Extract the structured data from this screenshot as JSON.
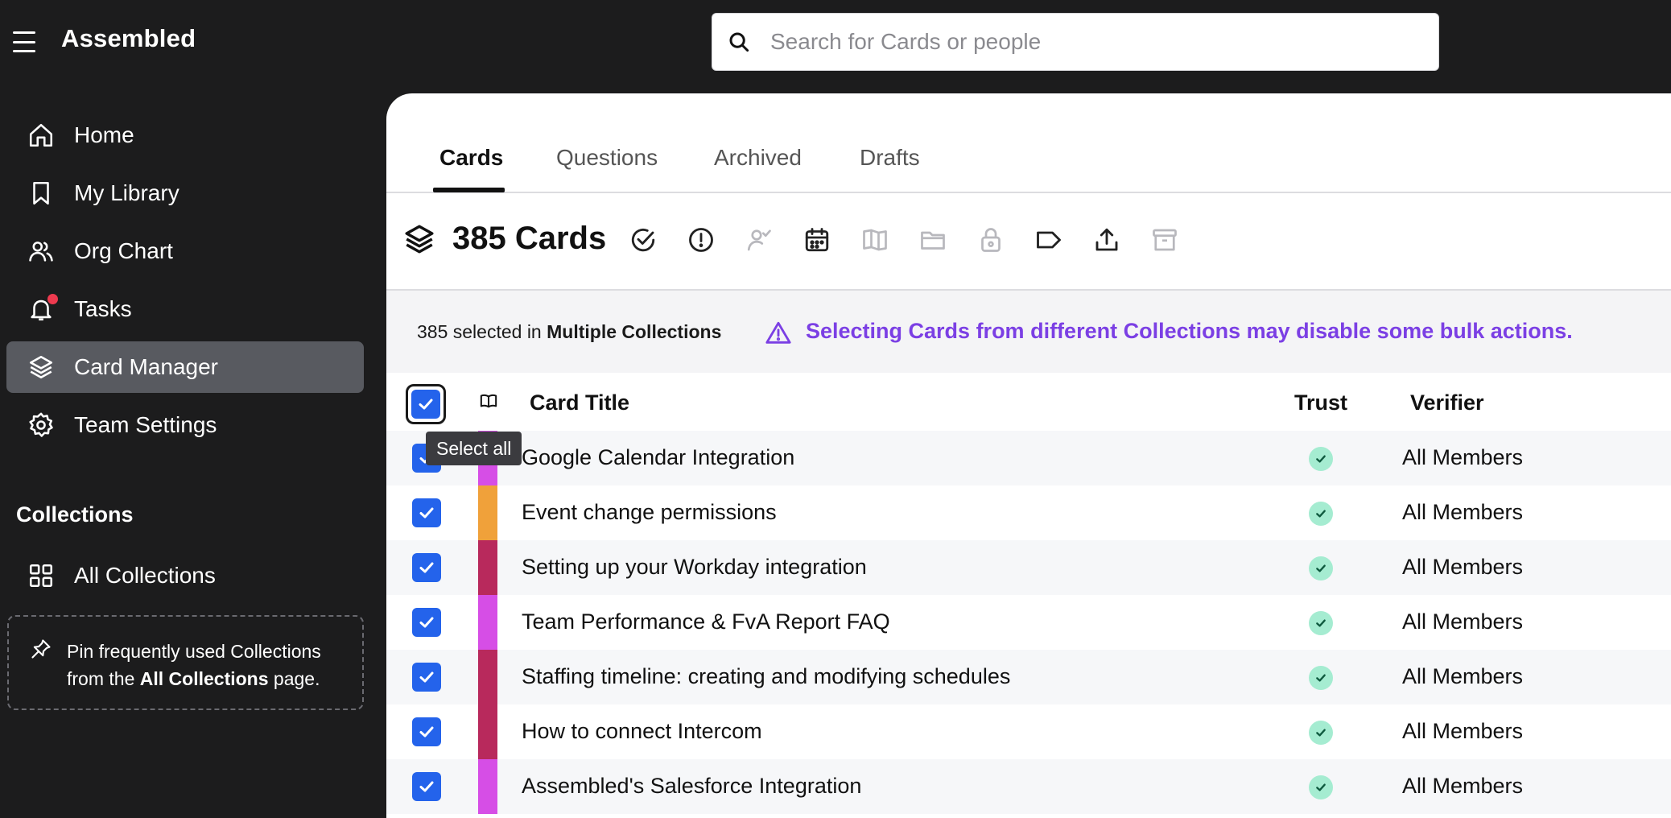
{
  "app": {
    "title": "Assembled"
  },
  "search": {
    "placeholder": "Search for Cards or people",
    "value": ""
  },
  "sidebar": {
    "items": [
      {
        "label": "Home",
        "icon": "home-icon"
      },
      {
        "label": "My Library",
        "icon": "bookmark-icon"
      },
      {
        "label": "Org Chart",
        "icon": "people-icon"
      },
      {
        "label": "Tasks",
        "icon": "bell-icon",
        "notification": true
      },
      {
        "label": "Card Manager",
        "icon": "layers-icon",
        "active": true
      },
      {
        "label": "Team Settings",
        "icon": "gear-icon"
      }
    ],
    "collections_heading": "Collections",
    "all_collections_label": "All Collections",
    "pin_text_prefix": "Pin frequently used Collections from the ",
    "pin_text_bold": "All Collections",
    "pin_text_suffix": " page."
  },
  "tabs": [
    {
      "label": "Cards",
      "active": true
    },
    {
      "label": "Questions"
    },
    {
      "label": "Archived"
    },
    {
      "label": "Drafts"
    }
  ],
  "toolbar": {
    "count_label": "385 Cards",
    "actions": [
      {
        "icon": "verify-check-icon",
        "enabled": true
      },
      {
        "icon": "alert-circle-icon",
        "enabled": true
      },
      {
        "icon": "assign-verifier-icon",
        "enabled": false
      },
      {
        "icon": "calendar-icon",
        "enabled": true
      },
      {
        "icon": "open-book-icon",
        "enabled": false
      },
      {
        "icon": "folder-icon",
        "enabled": false
      },
      {
        "icon": "lock-icon",
        "enabled": false
      },
      {
        "icon": "tag-icon",
        "enabled": true
      },
      {
        "icon": "export-icon",
        "enabled": true
      },
      {
        "icon": "archive-icon",
        "enabled": false
      }
    ]
  },
  "banner": {
    "selected_prefix": "385 selected in ",
    "selected_bold": "Multiple Collections",
    "warning": "Selecting Cards from different Collections may disable some bulk actions.",
    "warning_color": "#7b3fe4"
  },
  "table": {
    "columns": {
      "title": "Card Title",
      "trust": "Trust",
      "verifier": "Verifier"
    },
    "select_all_tooltip": "Select all",
    "rows": [
      {
        "title": "Google Calendar Integration",
        "verifier": "All Members",
        "color": "#d64ee6",
        "checked": true
      },
      {
        "title": "Event change permissions",
        "verifier": "All Members",
        "color": "#f0a13a",
        "checked": true
      },
      {
        "title": "Setting up your Workday integration",
        "verifier": "All Members",
        "color": "#b8295c",
        "checked": true
      },
      {
        "title": "Team Performance & FvA Report FAQ",
        "verifier": "All Members",
        "color": "#d64ee6",
        "checked": true
      },
      {
        "title": "Staffing timeline: creating and modifying schedules",
        "verifier": "All Members",
        "color": "#b8295c",
        "checked": true
      },
      {
        "title": "How to connect Intercom",
        "verifier": "All Members",
        "color": "#b8295c",
        "checked": true
      },
      {
        "title": "Assembled's Salesforce Integration",
        "verifier": "All Members",
        "color": "#d64ee6",
        "checked": true
      }
    ]
  },
  "colors": {
    "checkbox": "#2463eb",
    "trust_badge": "#a5ecd1",
    "active_nav": "#585a60"
  }
}
